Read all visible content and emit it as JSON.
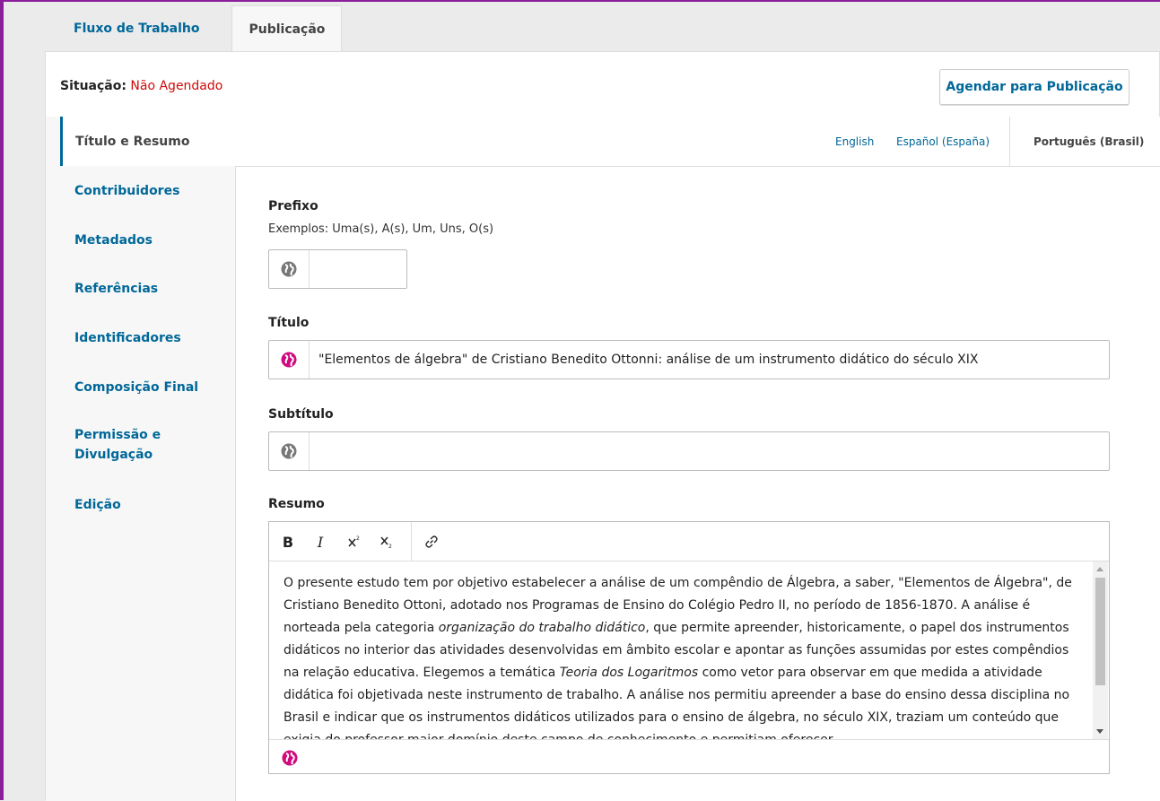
{
  "tabs": [
    {
      "label": "Fluxo de Trabalho"
    },
    {
      "label": "Publicação"
    }
  ],
  "status": {
    "label": "Situação:",
    "value": "Não Agendado"
  },
  "schedule_button": "Agendar para Publicação",
  "sidenav": {
    "active": "Título e Resumo",
    "items": [
      {
        "label": "Contribuidores"
      },
      {
        "label": "Metadados"
      },
      {
        "label": "Referências"
      },
      {
        "label": "Identificadores"
      },
      {
        "label": "Composição Final"
      },
      {
        "label": "Permissão e Divulgação"
      },
      {
        "label": "Edição"
      }
    ]
  },
  "locales": [
    {
      "label": "English"
    },
    {
      "label": "Español (España)"
    },
    {
      "label": "Português (Brasil)"
    }
  ],
  "form": {
    "prefix": {
      "label": "Prefixo",
      "description": "Exemplos: Uma(s), A(s), Um, Uns, O(s)",
      "value": ""
    },
    "title": {
      "label": "Título",
      "value": "\"Elementos de álgebra\" de Cristiano Benedito Ottonni: análise de um instrumento didático do século XIX"
    },
    "subtitle": {
      "label": "Subtítulo",
      "value": ""
    },
    "abstract": {
      "label": "Resumo",
      "toolbar": {
        "bold": "B",
        "italic": "I"
      },
      "parts": [
        "O presente estudo tem por objetivo estabelecer a análise de um compêndio de Álgebra, a saber, \"Elementos de Álgebra\", de Cristiano Benedito Ottoni, adotado nos Programas de Ensino do Colégio Pedro II, no período de 1856-1870. A análise é norteada pela categoria ",
        "organização do trabalho didático",
        ", que permite apreender, historicamente, o papel dos instrumentos didáticos no interior das atividades desenvolvidas em âmbito escolar e apontar as funções assumidas por estes compêndios na relação educativa. Elegemos a temática ",
        "Teoria dos Logaritmos",
        " como vetor para observar em que medida a atividade didática foi objetivada neste instrumento de trabalho. A análise nos permitiu apreender a base do ensino dessa disciplina no Brasil e indicar que os instrumentos didáticos utilizados para o ensino de álgebra, no século XIX, traziam um conteúdo que exigia do professor maior domínio deste campo de conhecimento e permitiam oferecer"
      ]
    }
  },
  "icons": {
    "globe_empty": "globe-icon",
    "globe_filled": "globe-filled-icon",
    "link": "link-icon"
  },
  "colors": {
    "accent": "#006798",
    "status": "#d00a0a",
    "globe_filled": "#d00a7e",
    "globe_empty": "#777777"
  }
}
